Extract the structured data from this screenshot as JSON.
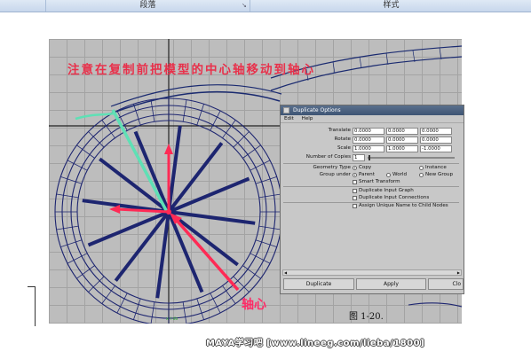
{
  "ribbon": {
    "groups": [
      {
        "label": ""
      },
      {
        "label": "段落"
      },
      {
        "label": "样式"
      }
    ]
  },
  "figure": {
    "annotation": "注意在复制前把模型的中心轴移动到轴心",
    "pivot_label": "轴心",
    "viewport_small_label": "x i ds",
    "caption": "图 1-20.",
    "watermark": "MAYA学习吧 [www.lineeg.com/lieba/1800]"
  },
  "dialog": {
    "title": "Duplicate Options",
    "menu": [
      "Edit",
      "Help"
    ],
    "translate": {
      "label": "Translate",
      "values": [
        "0.0000",
        "0.0000",
        "0.0000"
      ]
    },
    "rotate": {
      "label": "Rotate",
      "values": [
        "0.0000",
        "0.0000",
        "0.0000"
      ]
    },
    "scale": {
      "label": "Scale",
      "values": [
        "1.0000",
        "1.0000",
        "-1.0000"
      ]
    },
    "copies": {
      "label": "Number of Copies",
      "value": "1"
    },
    "geometry_type": {
      "label": "Geometry Type",
      "options": [
        "Copy",
        "Instance"
      ],
      "selected": "Copy"
    },
    "group_under": {
      "label": "Group under",
      "options": [
        "Parent",
        "World",
        "New Group"
      ],
      "selected": "Parent"
    },
    "checkboxes": [
      "Smart Transform",
      "Duplicate Input Graph",
      "Duplicate Input Connections",
      "Assign Unique Name to Child Nodes"
    ],
    "buttons": {
      "duplicate": "Duplicate",
      "apply": "Apply",
      "close": "Clo"
    }
  },
  "colors": {
    "spokes": "#1d2570",
    "pivot_arrows": "#ff2a55",
    "annotation": "#e8304a",
    "selected_curve": "#5fe0b5"
  }
}
